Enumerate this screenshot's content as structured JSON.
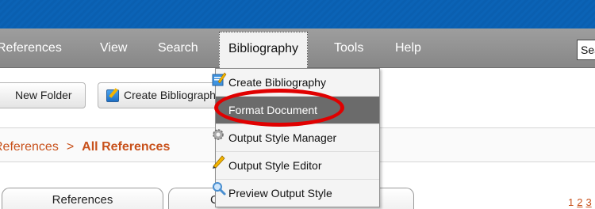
{
  "menubar": {
    "items": [
      "References",
      "View",
      "Search",
      "Bibliography",
      "Tools",
      "Help"
    ],
    "search_partial": "Sea"
  },
  "toolbar": {
    "new_folder": "New Folder",
    "create_bibliography": "Create Bibliography"
  },
  "breadcrumb": {
    "parent": "References",
    "separator": ">",
    "current": "All References"
  },
  "tabs": {
    "references": "References",
    "second_partial": "C"
  },
  "pager": [
    "1",
    "2",
    "3"
  ],
  "dropdown": {
    "items": [
      {
        "label": "Create Bibliography",
        "icon": "pencil-paper-icon"
      },
      {
        "label": "Format Document",
        "icon": ""
      },
      {
        "label": "Output Style Manager",
        "icon": "gear-icon"
      },
      {
        "label": "Output Style Editor",
        "icon": "pencil-icon"
      },
      {
        "label": "Preview Output Style",
        "icon": "magnifier-icon"
      }
    ],
    "highlighted_index": 1
  },
  "colors": {
    "top_band": "#0b63b6",
    "menubar": "#929292",
    "accent_orange": "#c8511b",
    "highlight": "#6b6b6b",
    "annotation_red": "#e00000"
  }
}
